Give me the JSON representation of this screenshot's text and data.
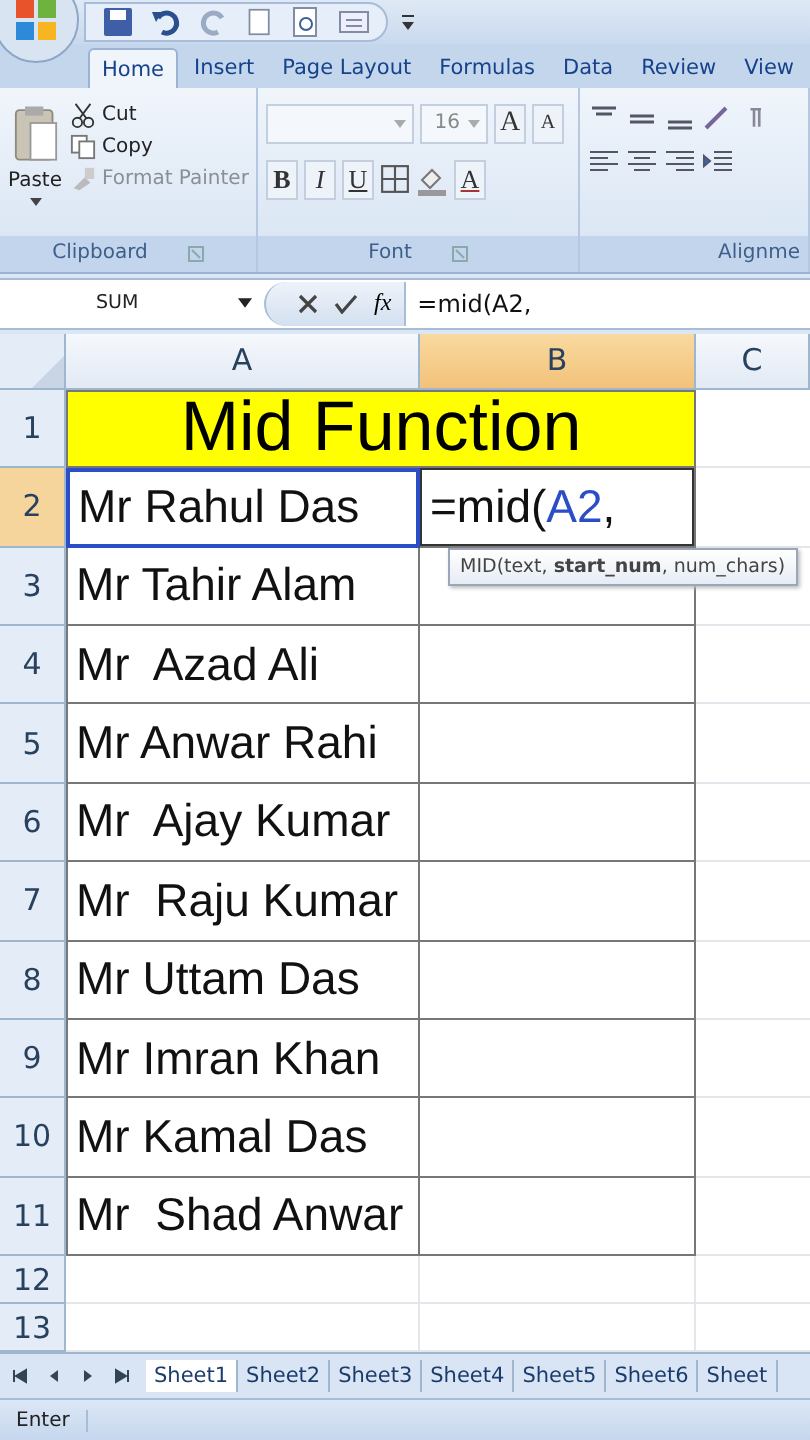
{
  "tabs": [
    {
      "label": "Home",
      "selected": true
    },
    {
      "label": "Insert",
      "selected": false
    },
    {
      "label": "Page Layout",
      "selected": false
    },
    {
      "label": "Formulas",
      "selected": false
    },
    {
      "label": "Data",
      "selected": false
    },
    {
      "label": "Review",
      "selected": false
    },
    {
      "label": "View",
      "selected": false
    }
  ],
  "clipboard": {
    "paste": "Paste",
    "label": "Clipboard",
    "commands": [
      {
        "label": "Cut",
        "disabled": false
      },
      {
        "label": "Copy",
        "disabled": false
      },
      {
        "label": "Format Painter",
        "disabled": true
      }
    ]
  },
  "font": {
    "label": "Font",
    "size": "16",
    "grow": "A",
    "shrink": "A",
    "bold": "B",
    "italic": "I",
    "underline": "U",
    "font_color": "A"
  },
  "alignment": {
    "label": "Alignme"
  },
  "formula_bar": {
    "name_box": "SUM",
    "function_button": "fx",
    "formula": "=mid(A2,"
  },
  "columns": [
    {
      "label": "A",
      "selected": false
    },
    {
      "label": "B",
      "selected": true
    },
    {
      "label": "C",
      "selected": false
    }
  ],
  "rows": [
    {
      "number": "1",
      "kind": "title",
      "text": "Mid Function",
      "selected": false
    },
    {
      "number": "2",
      "kind": "name",
      "text": "Mr Rahul Das",
      "selected": true,
      "referenced": true,
      "edit": {
        "prefix": "=mid(",
        "reference": "A2",
        "suffix": ",",
        "tooltip": "MID(text, **start_num**, num_chars)"
      }
    },
    {
      "number": "3",
      "kind": "name",
      "text": "Mr Tahir Alam",
      "selected": false,
      "referenced": false
    },
    {
      "number": "4",
      "kind": "name",
      "text": "Mr  Azad Ali",
      "selected": false,
      "referenced": false
    },
    {
      "number": "5",
      "kind": "name",
      "text": "Mr Anwar Rahi",
      "selected": false,
      "referenced": false
    },
    {
      "number": "6",
      "kind": "name",
      "text": "Mr  Ajay Kumar",
      "selected": false,
      "referenced": false
    },
    {
      "number": "7",
      "kind": "name",
      "text": "Mr  Raju Kumar",
      "selected": false,
      "referenced": false
    },
    {
      "number": "8",
      "kind": "name",
      "text": "Mr Uttam Das",
      "selected": false,
      "referenced": false
    },
    {
      "number": "9",
      "kind": "name",
      "text": "Mr Imran Khan",
      "selected": false,
      "referenced": false
    },
    {
      "number": "10",
      "kind": "name",
      "text": "Mr Kamal Das",
      "selected": false,
      "referenced": false
    },
    {
      "number": "11",
      "kind": "name",
      "text": "Mr  Shad Anwar",
      "selected": false,
      "referenced": false
    },
    {
      "number": "12",
      "kind": "empty",
      "selected": false
    },
    {
      "number": "13",
      "kind": "empty",
      "selected": false
    }
  ],
  "sheets": [
    {
      "label": "Sheet1",
      "selected": true
    },
    {
      "label": "Sheet2",
      "selected": false
    },
    {
      "label": "Sheet3",
      "selected": false
    },
    {
      "label": "Sheet4",
      "selected": false
    },
    {
      "label": "Sheet5",
      "selected": false
    },
    {
      "label": "Sheet6",
      "selected": false
    },
    {
      "label": "Sheet",
      "selected": false
    }
  ],
  "status_bar": {
    "mode": "Enter"
  }
}
